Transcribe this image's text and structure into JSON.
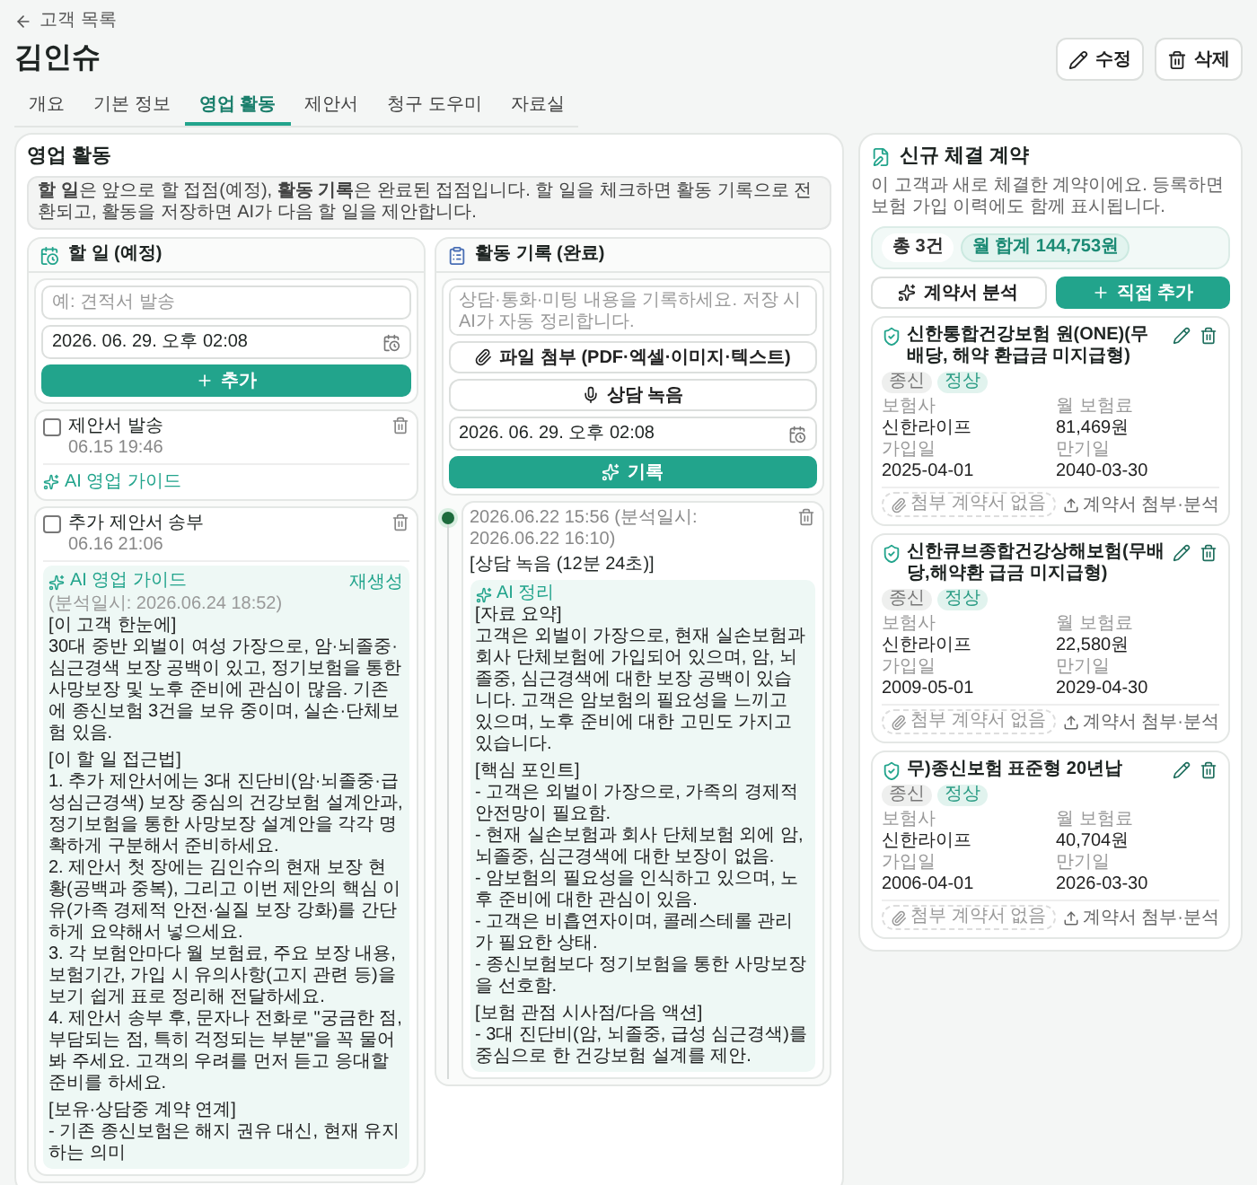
{
  "back_link": "고객 목록",
  "title": "김인슈",
  "header_buttons": [
    {
      "kind": "edit",
      "label": "수정"
    },
    {
      "kind": "delete",
      "label": "삭제"
    }
  ],
  "tabs": [
    {
      "label": "개요",
      "selected": false
    },
    {
      "label": "기본 정보",
      "selected": false
    },
    {
      "label": "영업 활동",
      "selected": true
    },
    {
      "label": "제안서",
      "selected": false
    },
    {
      "label": "청구 도우미",
      "selected": false
    },
    {
      "label": "자료실",
      "selected": false
    }
  ],
  "activity": {
    "title": "영업 활동",
    "notice": "**할 일**은 앞으로 할 접점(예정), **활동 기록**은 완료된 접점입니다. 할 일을 체크하면 활동 기록으로 전환되고, 활동을 저장하면 AI가 다음 할 일을 제안합니다.",
    "todo": {
      "title": "할 일 (예정)",
      "input_placeholder": "예: 견적서 발송",
      "datetime": "2026. 06. 29. 오후 02:08",
      "add_button": "추가",
      "items": [
        {
          "title": "제안서 발송",
          "time": "06.15 19:46",
          "checked": false,
          "guide": {
            "label": "AI 영업 가이드",
            "expanded": false
          }
        },
        {
          "title": "추가 제안서 송부",
          "time": "06.16 21:06",
          "checked": false,
          "guide": {
            "label": "AI 영업 가이드",
            "expanded": true,
            "analyzed": "(분석일시: 2026.06.24 18:52)",
            "regenerate": "재생성",
            "lines": [
              {
                "kind": "heading",
                "text": "[이 고객 한눈에]"
              },
              {
                "kind": "text",
                "text": "30대 중반 외벌이 여성 가장으로, 암·뇌졸중·심근경색 보장 공백이 있고, 정기보험을 통한 사망보장 및 노후 준비에 관심이 많음. 기존에 종신보험 3건을 보유 중이며, 실손·단체보험 있음."
              },
              {
                "kind": "heading",
                "text": "[이 할 일 접근법]"
              },
              {
                "kind": "text",
                "text": "1. 추가 제안서에는 3대 진단비(암·뇌졸중·급성심근경색) 보장 중심의 건강보험 설계안과, 정기보험을 통한 사망보장 설계안을 각각 명확하게 구분해서 준비하세요."
              },
              {
                "kind": "text",
                "text": "2. 제안서 첫 장에는 김인슈의 현재 보장 현황(공백과 중복), 그리고 이번 제안의 핵심 이유(가족 경제적 안전·실질 보장 강화)를 간단하게 요약해서 넣으세요."
              },
              {
                "kind": "text",
                "text": "3. 각 보험안마다 월 보험료, 주요 보장 내용, 보험기간, 가입 시 유의사항(고지 관련 등)을 보기 쉽게 표로 정리해 전달하세요."
              },
              {
                "kind": "text",
                "text": "4. 제안서 송부 후, 문자나 전화로 \"궁금한 점, 부담되는 점, 특히 걱정되는 부분\"을 꼭 물어봐 주세요. 고객의 우려를 먼저 듣고 응대할 준비를 하세요."
              },
              {
                "kind": "heading",
                "text": "[보유·상담중 계약 연계]"
              },
              {
                "kind": "text",
                "text": "- 기존 종신보험은 해지 권유 대신, 현재 유지하는 의미"
              }
            ]
          }
        }
      ]
    },
    "log": {
      "title": "활동 기록 (완료)",
      "placeholder": "상담·통화·미팅 내용을 기록하세요. 저장 시 AI가 자동 정리합니다.",
      "attach_button": "파일 첨부 (PDF·엑셀·이미지·텍스트)",
      "record_button": "상담 녹음",
      "datetime": "2026. 06. 29. 오후 02:08",
      "submit_button": "기록",
      "entries": [
        {
          "time": "2026.06.22 15:56",
          "analyzed": "(분석일시: 2026.06.22 16:10)",
          "title": "[상담 녹음 (12분 24초)]",
          "summary_label": "AI 정리",
          "lines": [
            {
              "kind": "heading",
              "text": "[자료 요약]"
            },
            {
              "kind": "text",
              "text": "고객은 외벌이 가장으로, 현재 실손보험과 회사 단체보험에 가입되어 있으며, 암, 뇌졸중, 심근경색에 대한 보장 공백이 있습니다. 고객은 암보험의 필요성을 느끼고 있으며, 노후 준비에 대한 고민도 가지고 있습니다."
            },
            {
              "kind": "heading",
              "text": "[핵심 포인트]"
            },
            {
              "kind": "text",
              "text": "- 고객은 외벌이 가장으로, 가족의 경제적 안전망이 필요함."
            },
            {
              "kind": "text",
              "text": "- 현재 실손보험과 회사 단체보험 외에 암, 뇌졸중, 심근경색에 대한 보장이 없음."
            },
            {
              "kind": "text",
              "text": "- 암보험의 필요성을 인식하고 있으며, 노후 준비에 대한 관심이 있음."
            },
            {
              "kind": "text",
              "text": "- 고객은 비흡연자이며, 콜레스테롤 관리가 필요한 상태."
            },
            {
              "kind": "text",
              "text": "- 종신보험보다 정기보험을 통한 사망보장을 선호함."
            },
            {
              "kind": "heading",
              "text": "[보험 관점 시사점/다음 액션]"
            },
            {
              "kind": "text",
              "text": "- 3대 진단비(암, 뇌졸중, 급성 심근경색)를 중심으로 한 건강보험 설계를 제안."
            }
          ]
        }
      ]
    }
  },
  "contracts": {
    "title": "신규 체결 계약",
    "description": "이 고객과 새로 체결한 계약이에요. 등록하면 보험 가입 이력에도 함께 표시됩니다.",
    "total": "총 3건",
    "monthly_total": "월 합계 144,753원",
    "analyze_button": "계약서 분석",
    "add_button": "직접 추가",
    "items": [
      {
        "name": "신한통합건강보험 원(ONE)(무배당, 해약 환급금 미지급형)",
        "tags": [
          {
            "kind": "type",
            "label": "종신"
          },
          {
            "kind": "status",
            "label": "정상"
          }
        ],
        "fields": [
          {
            "label": "보험사",
            "value": "신한라이프"
          },
          {
            "label": "월 보험료",
            "value": "81,469원"
          },
          {
            "label": "가입일",
            "value": "2025-04-01"
          },
          {
            "label": "만기일",
            "value": "2040-03-30"
          }
        ],
        "attachment": "첨부 계약서 없음",
        "upload": "계약서 첨부·분석"
      },
      {
        "name": "신한큐브종합건강상해보험(무배당,해약환 급금 미지급형)",
        "tags": [
          {
            "kind": "type",
            "label": "종신"
          },
          {
            "kind": "status",
            "label": "정상"
          }
        ],
        "fields": [
          {
            "label": "보험사",
            "value": "신한라이프"
          },
          {
            "label": "월 보험료",
            "value": "22,580원"
          },
          {
            "label": "가입일",
            "value": "2009-05-01"
          },
          {
            "label": "만기일",
            "value": "2029-04-30"
          }
        ],
        "attachment": "첨부 계약서 없음",
        "upload": "계약서 첨부·분석"
      },
      {
        "name": "무)종신보험 표준형 20년납",
        "tags": [
          {
            "kind": "type",
            "label": "종신"
          },
          {
            "kind": "status",
            "label": "정상"
          }
        ],
        "fields": [
          {
            "label": "보험사",
            "value": "신한라이프"
          },
          {
            "label": "월 보험료",
            "value": "40,704원"
          },
          {
            "label": "가입일",
            "value": "2006-04-01"
          },
          {
            "label": "만기일",
            "value": "2026-03-30"
          }
        ],
        "attachment": "첨부 계약서 없음",
        "upload": "계약서 첨부·분석"
      }
    ]
  }
}
